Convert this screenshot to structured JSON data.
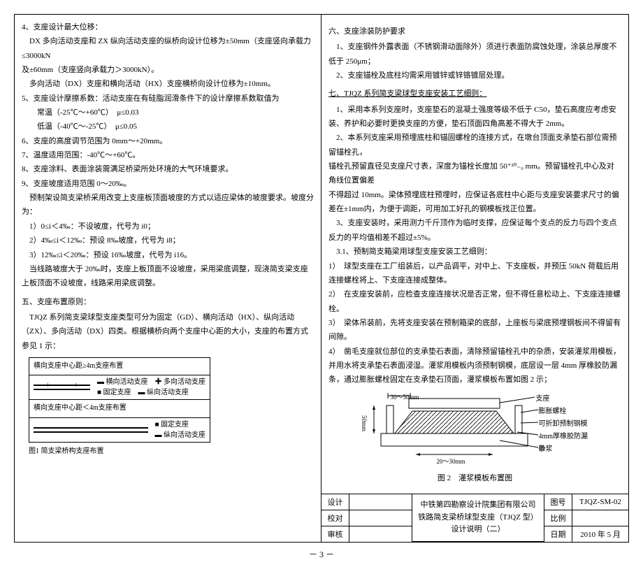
{
  "left": {
    "i4_title": "4、支座设计最大位移：",
    "i4_l1": "DX 多向活动支座和 ZX 纵向活动支座的纵桥向设计位移为±50mm（支座竖向承载力≤3000kN",
    "i4_l2": "及±60mm（支座竖向承载力＞3000kN）。",
    "i4_l3": "多向活动（DX）支座和横向活动（HX）支座横桥向设计位移为±10mm。",
    "i5_title": "5、支座设计摩擦系数：活动支座在有硅脂润滑条件下的设计摩擦系数取值为",
    "i5_l1": "常温（-25℃～+60℃）　μ≤0.03",
    "i5_l2": "低温（-40℃～-25℃）　μ≤0.05",
    "i6": "6、支座的高度调节范围为 0mm～+20mm。",
    "i7": "7、温度适用范围：-40℃～+60℃。",
    "i8": "8、支座涂料、表面涂装需满足桥梁所处环境的大气环境要求。",
    "i9_title": "9、支座坡度适用范围 0～20‰。",
    "i9_l1": "预制架设简支梁桥采用改变上支座板顶面坡度的方式以适应梁体的坡度要求。坡度分为：",
    "i9_l2": "1）0≤i＜4‰：不设坡度，代号为 i0；",
    "i9_l3": "2）4‰≤i＜12‰：预设 8‰坡度，代号为 i8；",
    "i9_l4": "3）12‰≤i＜20‰：预设 16‰坡度，代号为 i16。",
    "i9_l5": "当线路坡度大于 20‰时，支座上板顶面不设坡度，采用梁底调整，现浇简支梁支座上板顶面不设坡度，线路采用梁底调整。",
    "sec5_title": "五、支座布置原则：",
    "sec5_l1": "TJQZ 系列简支梁球型支座类型可分为固定（GD）、横向活动（HX）、纵向活动（ZX）、多向活动（DX）四类。根据横桥向两个支座中心距的大小，支座的布置方式参见 1 示：",
    "dia_header_a": "横向支座中心距≥4m支座布置",
    "dia_header_b": "横向支座中心距＜4m支座布置",
    "dia_leg_a1": "横向活动支座",
    "dia_leg_a2": "固定支座",
    "dia_leg_b1": "多向活动支座",
    "dia_leg_b2": "纵向活动支座",
    "dia_leg_c1": "固定支座",
    "dia_leg_c2": "纵向活动支座",
    "dia_caption": "图1 简支梁桥构支座布置"
  },
  "right": {
    "sec6_title": "六、支座涂装防护要求",
    "sec6_l1": "1、支座钢件外露表面（不锈钢滑动面除外）须进行表面防腐蚀处理，涂装总厚度不低于 250μm；",
    "sec6_l2": "2、支座锚栓及底柱均需采用镀锌或锌铬镀层处理。",
    "sec7_title": "七、TJQZ 系列简支梁球型支座安装工艺细则：",
    "sec7_l1": "1、采用本系列支座时，支座垫石的混凝土强度等级不低于 C50，垫石高度应考虑安装、养护和必要时更换支座的方便，垫石顶面四角高差不得大于 2mm。",
    "sec7_l2": "2、本系列支座采用预埋底柱和锚固螺栓的连接方式，在墩台顶面支承垫石部位需预留锚栓孔，",
    "sec7_l2b": "锚栓孔预留直径见支座尺寸表，深度为锚栓长度加 50⁺²⁰₋₀ mm。预留锚栓孔中心及对角线位置偏差",
    "sec7_l2c": "不得超过 10mm。梁体预埋底柱预埋时，应保证各底柱中心距与支座安装要求尺寸的偏差在±1mm内，为便于调距，可用加工好孔的钢模板找正位置。",
    "sec7_l3": "3、支座安装时，采用测力千斤顶作为临时支撑，应保证每个支点的反力与四个支点反力的平均值相差不超过±5%。",
    "sec7_l4_title": "3.1、预制简支箱梁用球型支座安装工艺细则：",
    "sec7_l4_1": "1）　球型支座在工厂组装后，以产品调平，对中上、下支座板，并预压 50kN 荷载后用连接螺栓将上、下支座连接成整体。",
    "sec7_l4_2": "2）　在支座安装前，应检查支座连接状况是否正常，但不得任意松动上、下支座连接螺栓。",
    "sec7_l4_3": "3）　梁体吊装前，先将支座安装在预制箱梁的底部，上座板与梁底预埋钢板间不得留有间隙。",
    "sec7_l4_4": "4）　凿毛支座就位部位的支承垫石表面，清除预留锚栓孔中的杂质，安装灌浆用模板，并用水将支承垫石表面浸湿。灌浆用模板内须预制钢模，底层设一层 4mm 厚橡胶防漏条，通过膨胀螺栓固定在支承垫石顶面，灌浆模板布置如图 2 示；",
    "fig2_dim_top": "30～50mm",
    "fig2_dim_bot": "20～30mm",
    "fig2_dim_h": "50mm",
    "fig2_lab1": "支座",
    "fig2_lab2": "膨胀螺栓",
    "fig2_lab3": "可折卸预制钢模",
    "fig2_lab4": "4mm厚橡胶防漏条",
    "fig2_lab5": "砂浆",
    "fig2_caption": "图 2　灌浆模板布置图"
  },
  "titleblock": {
    "r1": "设计",
    "r2": "校对",
    "r3": "审核",
    "mid1": "中铁第四勘察设计院集团有限公司",
    "mid2": "铁路简支梁桥球型支座（TJQZ 型）",
    "mid3": "设计说明（二）",
    "c1": "图号",
    "c1v": "TJQZ-SM-02",
    "c2": "比例",
    "c2v": "",
    "c3": "日期",
    "c3v": "2010 年 5 月"
  },
  "footer": "－ 3 －"
}
